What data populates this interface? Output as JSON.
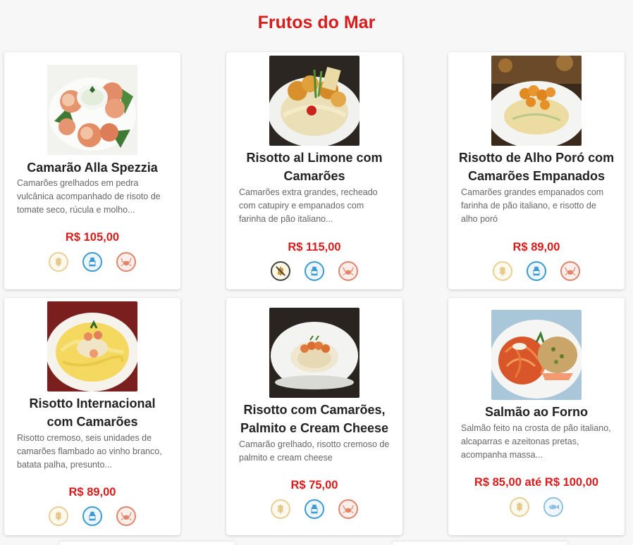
{
  "section_title": "Frutos do Mar",
  "dishes": [
    {
      "name_lines": [
        "Camarão Alla Spezzia"
      ],
      "description": "Camarões grelhados em pedra vulcânica acompanhado de risoto de tomate seco, rúcula e molho...",
      "price": "R$ 105,00",
      "allergen_icons": [
        "gluten-icon",
        "lactose-icon",
        "shellfish-icon"
      ]
    },
    {
      "name_lines": [
        "Risotto al Limone com",
        "Camarões"
      ],
      "description": "Camarões extra grandes, recheado com catupiry e empanados com farinha de pão italiano...",
      "price": "R$ 115,00",
      "allergen_icons": [
        "gluten-free-icon",
        "lactose-icon",
        "shellfish-icon"
      ]
    },
    {
      "name_lines": [
        "Risotto de Alho Poró com",
        "Camarões Empanados"
      ],
      "description": "Camarões grandes empanados com farinha de pão italiano, e risotto de alho poró",
      "price": "R$ 89,00",
      "allergen_icons": [
        "gluten-icon",
        "lactose-icon",
        "shellfish-icon"
      ]
    },
    {
      "name_lines": [
        "Risotto Internacional",
        "com Camarões"
      ],
      "description": "Risotto cremoso, seis unidades de camarões flambado ao vinho branco, batata palha, presunto...",
      "price": "R$ 89,00",
      "allergen_icons": [
        "gluten-icon",
        "lactose-icon",
        "shellfish-icon"
      ]
    },
    {
      "name_lines": [
        "Risotto com Camarões,",
        "Palmito e Cream Cheese"
      ],
      "description": "Camarão grelhado, risotto cremoso de palmito e cream cheese",
      "price": "R$ 75,00",
      "allergen_icons": [
        "gluten-icon",
        "lactose-icon",
        "shellfish-icon"
      ]
    },
    {
      "name_lines": [
        "Salmão ao Forno"
      ],
      "description": "Salmão feito na crosta de pão italiano, alcaparras e azeitonas pretas, acompanha massa...",
      "price": "R$ 85,00 até R$ 100,00",
      "allergen_icons": [
        "gluten-icon",
        "fish-icon"
      ]
    }
  ],
  "colors": {
    "accent_red": "#d71c1c",
    "gluten": "#e8cf96",
    "lactose": "#3a9bd5",
    "shellfish": "#e0856b",
    "fish": "#8fc0e6"
  }
}
